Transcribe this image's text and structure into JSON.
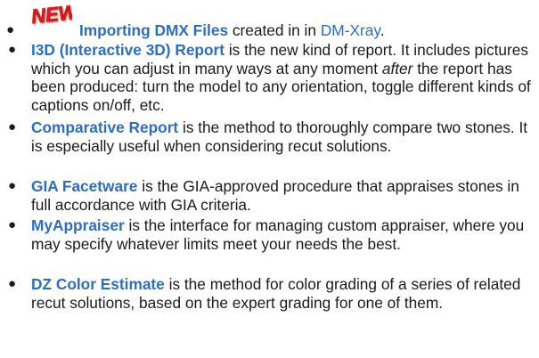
{
  "badge": {
    "text": "NEW",
    "color": "#e01b1b"
  },
  "items": [
    {
      "term": "Importing DMX Files",
      "text_before_link": " created in in ",
      "link": "DM-Xray",
      "text_after_link": "."
    },
    {
      "term": "I3D (Interactive 3D) Report",
      "text_1": " is the new kind of report. It includes pictures which you can adjust in many ways at any moment ",
      "emphasis": "after",
      "text_2": " the report has been produced: turn the model to any orientation, toggle different kinds of captions on/off, etc."
    },
    {
      "term": "Comparative Report",
      "text": " is the method to thoroughly compare two stones. It is especially useful when considering recut solutions."
    },
    {
      "term": "GIA Facetware",
      "text": " is the GIA-approved procedure that appraises stones in full accordance with GIA criteria."
    },
    {
      "term": "MyAppraiser",
      "text": " is the interface for managing custom appraiser, where you may specify whatever limits meet your needs the best."
    },
    {
      "term": "DZ Color Estimate",
      "text": " is the method for color grading of a series of related recut solutions, based on the expert grading for one of them."
    }
  ],
  "colors": {
    "link": "#2f6dbf",
    "text": "#1a1a1a"
  }
}
